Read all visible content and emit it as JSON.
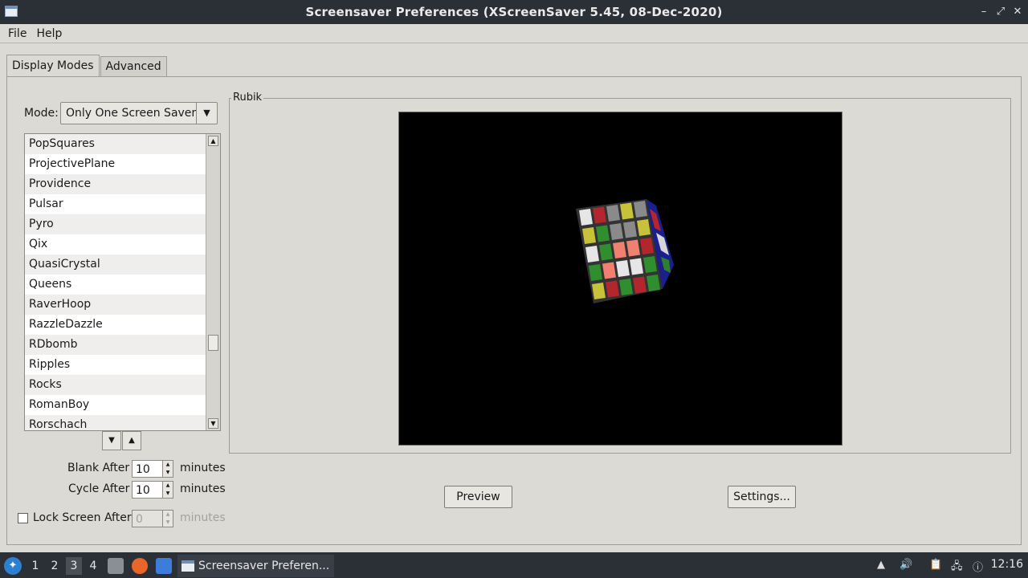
{
  "window": {
    "title": "Screensaver Preferences  (XScreenSaver 5.45, 08-Dec-2020)",
    "controls": [
      "minimize-icon",
      "maximize-icon",
      "close-icon"
    ]
  },
  "menu": {
    "file": "File",
    "help": "Help"
  },
  "tabs": [
    {
      "label": "Display Modes",
      "active": true
    },
    {
      "label": "Advanced",
      "active": false
    }
  ],
  "mode": {
    "label": "Mode:",
    "selected": "Only One Screen Saver"
  },
  "savers": [
    "PopSquares",
    "ProjectivePlane",
    "Providence",
    "Pulsar",
    "Pyro",
    "Qix",
    "QuasiCrystal",
    "Queens",
    "RaverHoop",
    "RazzleDazzle",
    "RDbomb",
    "Ripples",
    "Rocks",
    "RomanBoy",
    "Rorschach"
  ],
  "list_scroll_position": 0.67,
  "blank": {
    "label": "Blank After",
    "value": "10",
    "unit": "minutes"
  },
  "cycle": {
    "label": "Cycle After",
    "value": "10",
    "unit": "minutes"
  },
  "lock": {
    "label": "Lock Screen After",
    "value": "0",
    "unit": "minutes",
    "checked": false,
    "enabled": false
  },
  "preview": {
    "frame_title": "Rubik"
  },
  "buttons": {
    "preview": "Preview",
    "settings": "Settings..."
  },
  "taskbar": {
    "workspaces": [
      "1",
      "2",
      "3",
      "4"
    ],
    "active_workspace": "3",
    "launchers": [
      "file-manager-icon",
      "firefox-icon",
      "terminal-icon"
    ],
    "task": "Screensaver Preferen...",
    "tray": [
      "notification-up-icon",
      "volume-icon",
      "clipboard-icon",
      "network-icon",
      "update-icon"
    ],
    "clock": "12:16"
  },
  "colors": {
    "window_bg": "#dcdad5",
    "titlebar_bg": "#2b2f36",
    "preview_bg": "#000000",
    "accent": "#2f7fd1"
  }
}
